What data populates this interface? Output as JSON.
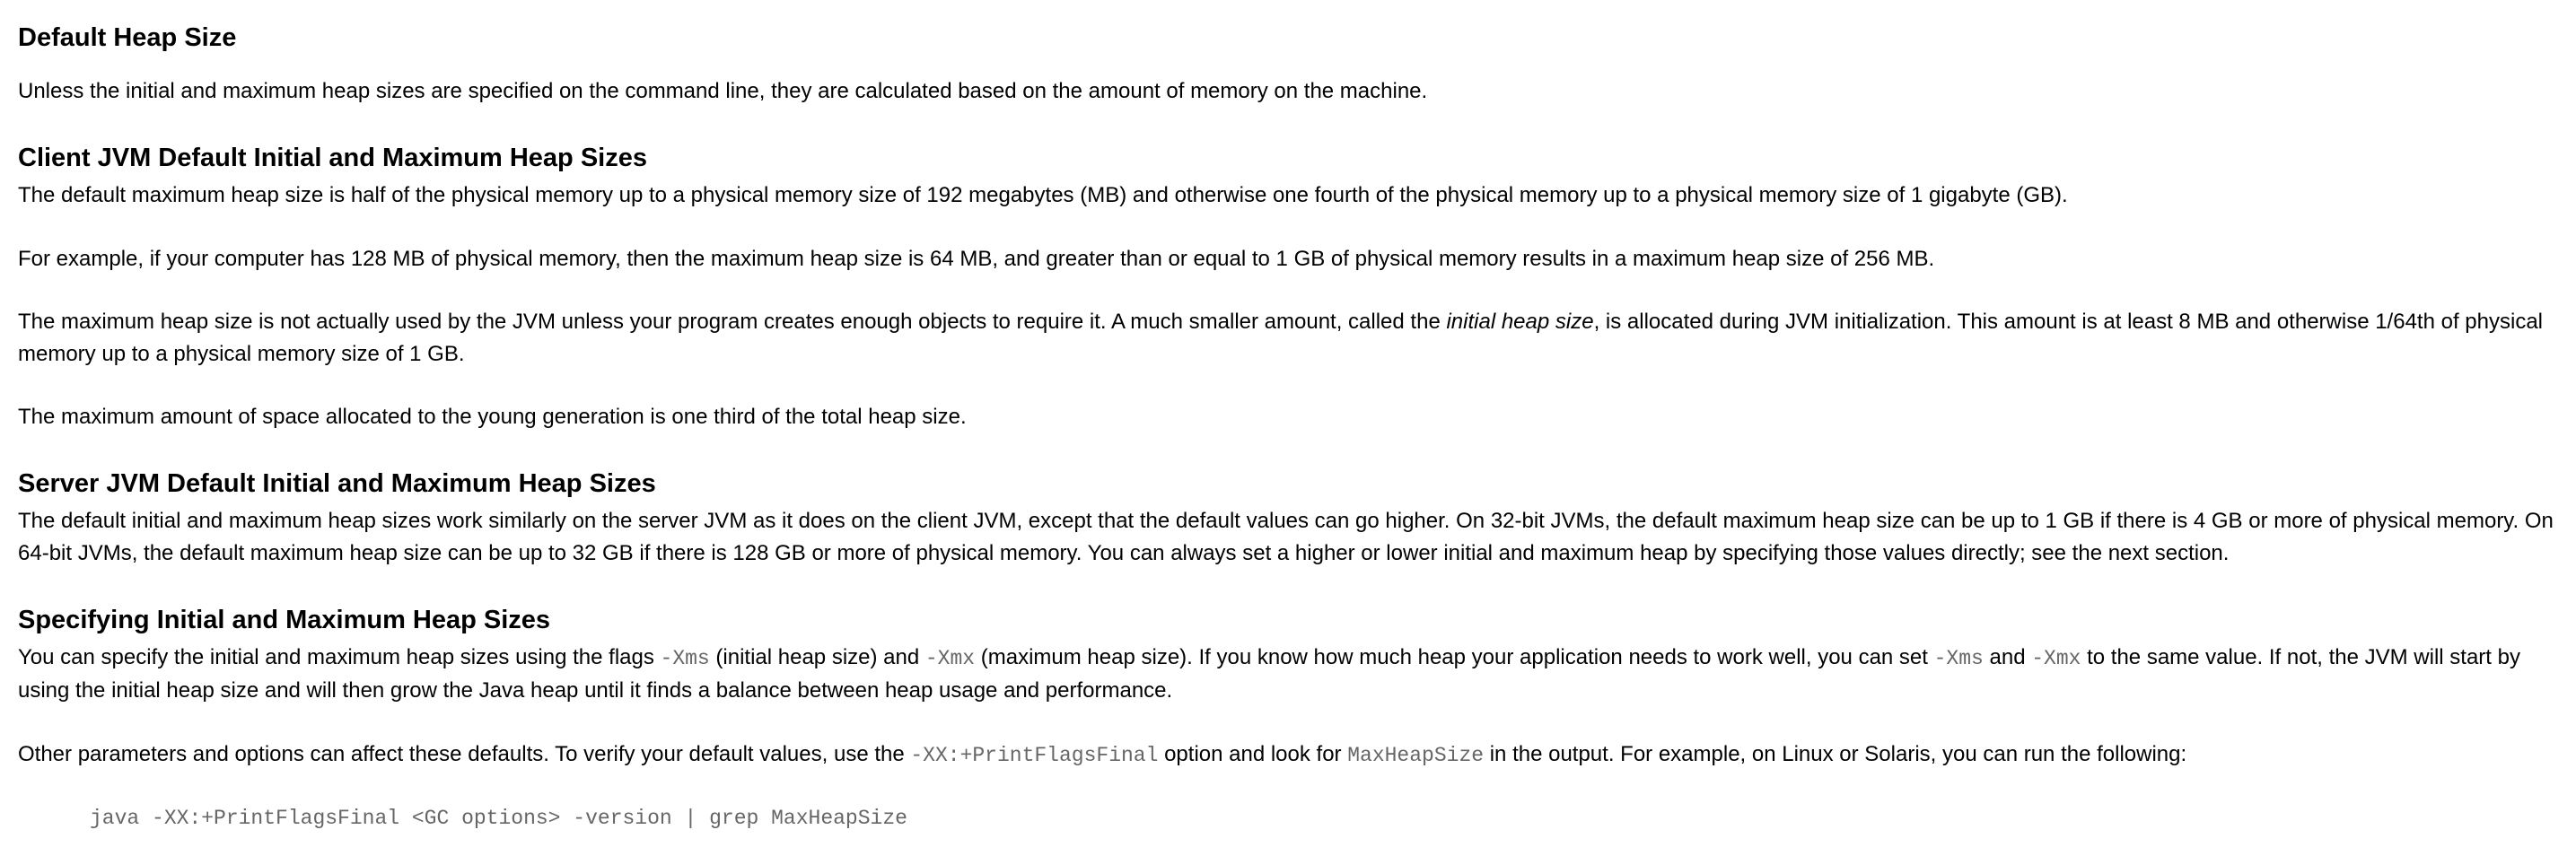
{
  "heading_main": "Default Heap Size",
  "intro": "Unless the initial and maximum heap sizes are specified on the command line, they are calculated based on the amount of memory on the machine.",
  "client": {
    "heading": "Client JVM Default Initial and Maximum Heap Sizes",
    "p1": "The default maximum heap size is half of the physical memory up to a physical memory size of 192 megabytes (MB) and otherwise one fourth of the physical memory up to a physical memory size of 1 gigabyte (GB).",
    "p2": "For example, if your computer has 128 MB of physical memory, then the maximum heap size is 64 MB, and greater than or equal to 1 GB of physical memory results in a maximum heap size of 256 MB.",
    "p3_a": "The maximum heap size is not actually used by the JVM unless your program creates enough objects to require it. A much smaller amount, called the ",
    "p3_em": "initial heap size",
    "p3_b": ", is allocated during JVM initialization. This amount is at least 8 MB and otherwise 1/64th of physical memory up to a physical memory size of 1 GB.",
    "p4": "The maximum amount of space allocated to the young generation is one third of the total heap size."
  },
  "server": {
    "heading": "Server JVM Default Initial and Maximum Heap Sizes",
    "p1": "The default initial and maximum heap sizes work similarly on the server JVM as it does on the client JVM, except that the default values can go higher. On 32-bit JVMs, the default maximum heap size can be up to 1 GB if there is 4 GB or more of physical memory. On 64-bit JVMs, the default maximum heap size can be up to 32 GB if there is 128 GB or more of physical memory. You can always set a higher or lower initial and maximum heap by specifying those values directly; see the next section."
  },
  "specifying": {
    "heading": "Specifying Initial and Maximum Heap Sizes",
    "p1_a": "You can specify the initial and maximum heap sizes using the flags ",
    "flag_xms": "-Xms",
    "p1_b": " (initial heap size) and ",
    "flag_xmx": "-Xmx",
    "p1_c": " (maximum heap size). If you know how much heap your application needs to work well, you can set ",
    "p1_d": " and ",
    "p1_e": " to the same value. If not, the JVM will start by using the initial heap size and will then grow the Java heap until it finds a balance between heap usage and performance.",
    "p2_a": "Other parameters and options can affect these defaults. To verify your default values, use the ",
    "flag_print": "-XX:+PrintFlagsFinal",
    "p2_b": " option and look for ",
    "flag_maxheap": "MaxHeapSize",
    "p2_c": " in the output. For example, on Linux or Solaris, you can run the following:",
    "command": "java -XX:+PrintFlagsFinal <GC options> -version | grep MaxHeapSize"
  }
}
